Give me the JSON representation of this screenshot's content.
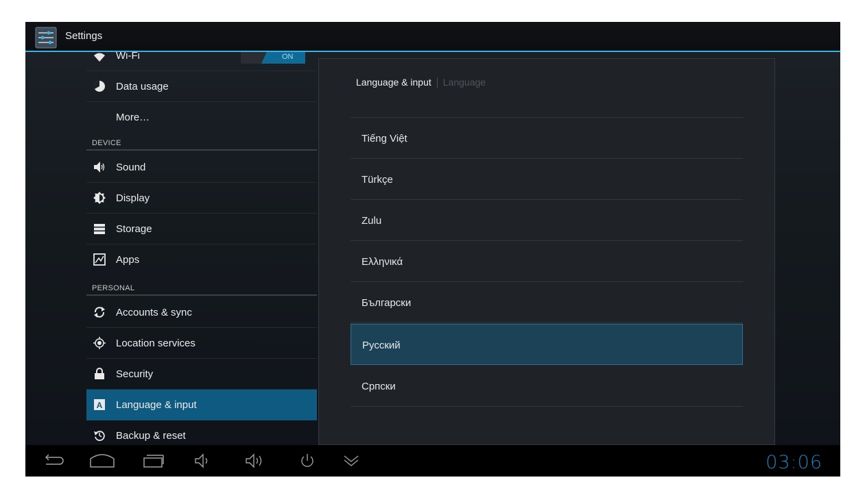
{
  "action_bar": {
    "title": "Settings",
    "app_icon": "settings-sliders-icon"
  },
  "sidebar": {
    "wifi": {
      "label": "Wi-Fi",
      "toggle": "ON",
      "icon": "wifi-icon"
    },
    "items": [
      {
        "label": "Data usage",
        "icon": "data-usage-icon"
      },
      {
        "label": "More…",
        "icon": ""
      }
    ],
    "device_header": "DEVICE",
    "device_items": [
      {
        "label": "Sound",
        "icon": "sound-icon"
      },
      {
        "label": "Display",
        "icon": "display-icon"
      },
      {
        "label": "Storage",
        "icon": "storage-icon"
      },
      {
        "label": "Apps",
        "icon": "apps-icon"
      }
    ],
    "personal_header": "PERSONAL",
    "personal_items": [
      {
        "label": "Accounts & sync",
        "icon": "sync-icon"
      },
      {
        "label": "Location services",
        "icon": "location-icon"
      },
      {
        "label": "Security",
        "icon": "lock-icon"
      },
      {
        "label": "Language & input",
        "icon": "language-icon",
        "selected": true
      },
      {
        "label": "Backup & reset",
        "icon": "backup-icon"
      }
    ]
  },
  "dialog": {
    "breadcrumb_parent": "Language & input",
    "breadcrumb_current": "Language",
    "languages": [
      "Tiếng Việt",
      "Türkçe",
      "Zulu",
      "Ελληνικά",
      "Български",
      "Русский",
      "Српски"
    ],
    "selected_language": "Русский"
  },
  "navbar": {
    "icons": [
      "back-icon",
      "home-icon",
      "recent-apps-icon",
      "volume-down-icon",
      "volume-up-icon",
      "power-icon",
      "collapse-icon"
    ],
    "clock": "03:06"
  },
  "colors": {
    "accent": "#33b5e5",
    "selected": "#0e5a80",
    "clock": "#1a7fb8"
  }
}
